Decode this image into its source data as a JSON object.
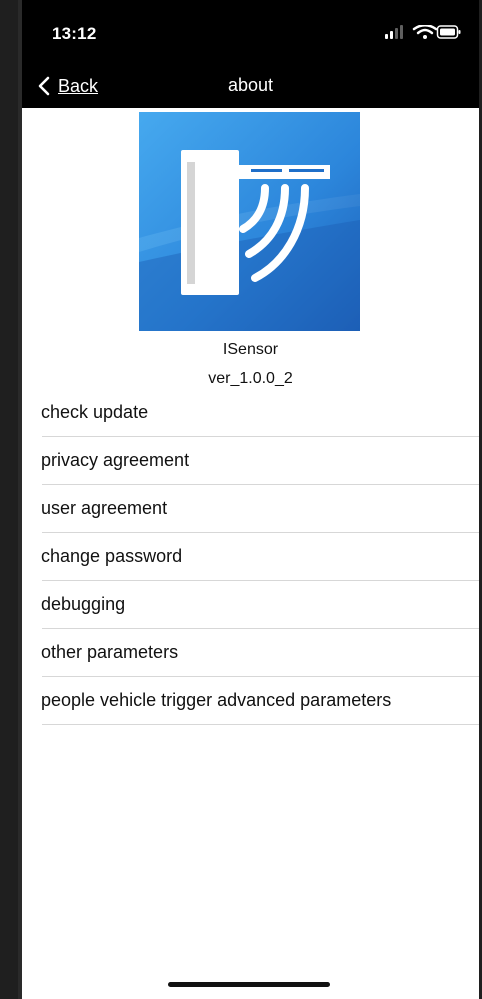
{
  "status_bar": {
    "time": "13:12"
  },
  "nav": {
    "back_label": "Back",
    "title": "about"
  },
  "app": {
    "name": "ISensor",
    "version": "ver_1.0.0_2"
  },
  "menu": [
    {
      "label": "check update"
    },
    {
      "label": "privacy agreement"
    },
    {
      "label": "user agreement"
    },
    {
      "label": "change password"
    },
    {
      "label": "debugging"
    },
    {
      "label": "other parameters"
    },
    {
      "label": "people vehicle trigger advanced parameters"
    }
  ],
  "colors": {
    "header_background": "#000000",
    "logo_blue": "#2d7ed8",
    "text": "#111111",
    "divider": "#d7d7d7"
  },
  "icons": {
    "back": "chevron-left-icon",
    "signal": "signal-icon",
    "wifi": "wifi-icon",
    "battery": "battery-icon",
    "logo": "barrier-sensor-icon"
  }
}
